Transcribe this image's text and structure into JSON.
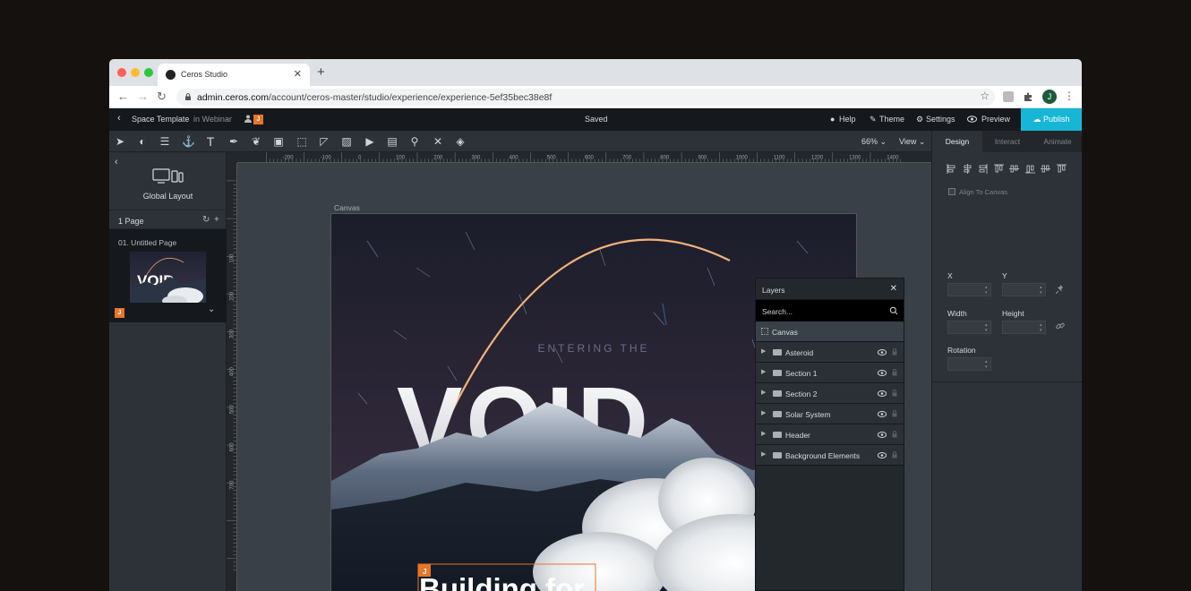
{
  "browser": {
    "tab_title": "Ceros Studio",
    "url_domain": "admin.ceros.com",
    "url_path": "/account/ceros-master/studio/experience/experience-5ef35bec38e8f",
    "profile_initial": "J",
    "colors": {
      "close": "#ff5f57",
      "minimize": "#febc2e",
      "maximize": "#28c840"
    }
  },
  "header": {
    "project_name": "Space Template",
    "folder": "in Webinar",
    "user_badge": "J",
    "status": "Saved",
    "help": "Help",
    "theme": "Theme",
    "settings": "Settings",
    "preview": "Preview",
    "publish": "Publish",
    "accent_color": "#17b6d6"
  },
  "toolbar": {
    "tools": [
      "select-tool",
      "shape-tool",
      "line-tool",
      "anchor-tool",
      "text-tool",
      "pen-tool",
      "icon-tool",
      "embed-tool",
      "hotspot-tool",
      "draw-tool",
      "image-tool",
      "video-tool",
      "svg-tool",
      "component-tool",
      "collision-tool",
      "layers-tool"
    ],
    "zoom": "66%",
    "view": "View"
  },
  "left_panel": {
    "layout_label": "Global Layout",
    "page_count": "1 Page",
    "pages": [
      {
        "label": "01.  Untitled Page",
        "badge": "J"
      }
    ]
  },
  "rulers": {
    "top": [
      "-200",
      "-100",
      "0",
      "100",
      "200",
      "300",
      "400",
      "500",
      "600",
      "700",
      "800",
      "900",
      "1000",
      "1100",
      "1200",
      "1300",
      "1400"
    ],
    "left": [
      "100",
      "200",
      "300",
      "400",
      "500",
      "600",
      "700"
    ]
  },
  "canvas": {
    "label": "Canvas",
    "kicker": "ENTERING THE",
    "headline": "VOID",
    "bottom_text": "Building for",
    "selection_badge": "J"
  },
  "layers_panel": {
    "title": "Layers",
    "search_placeholder": "Search...",
    "root": "Canvas",
    "items": [
      "Asteroid",
      "Section 1",
      "Section 2",
      "Solar System",
      "Header",
      "Background Elements"
    ]
  },
  "right_panel": {
    "tabs": [
      "Design",
      "Interact",
      "Animate"
    ],
    "align_to_canvas": "Align To Canvas",
    "x_label": "X",
    "y_label": "Y",
    "width_label": "Width",
    "height_label": "Height",
    "rotation_label": "Rotation"
  }
}
